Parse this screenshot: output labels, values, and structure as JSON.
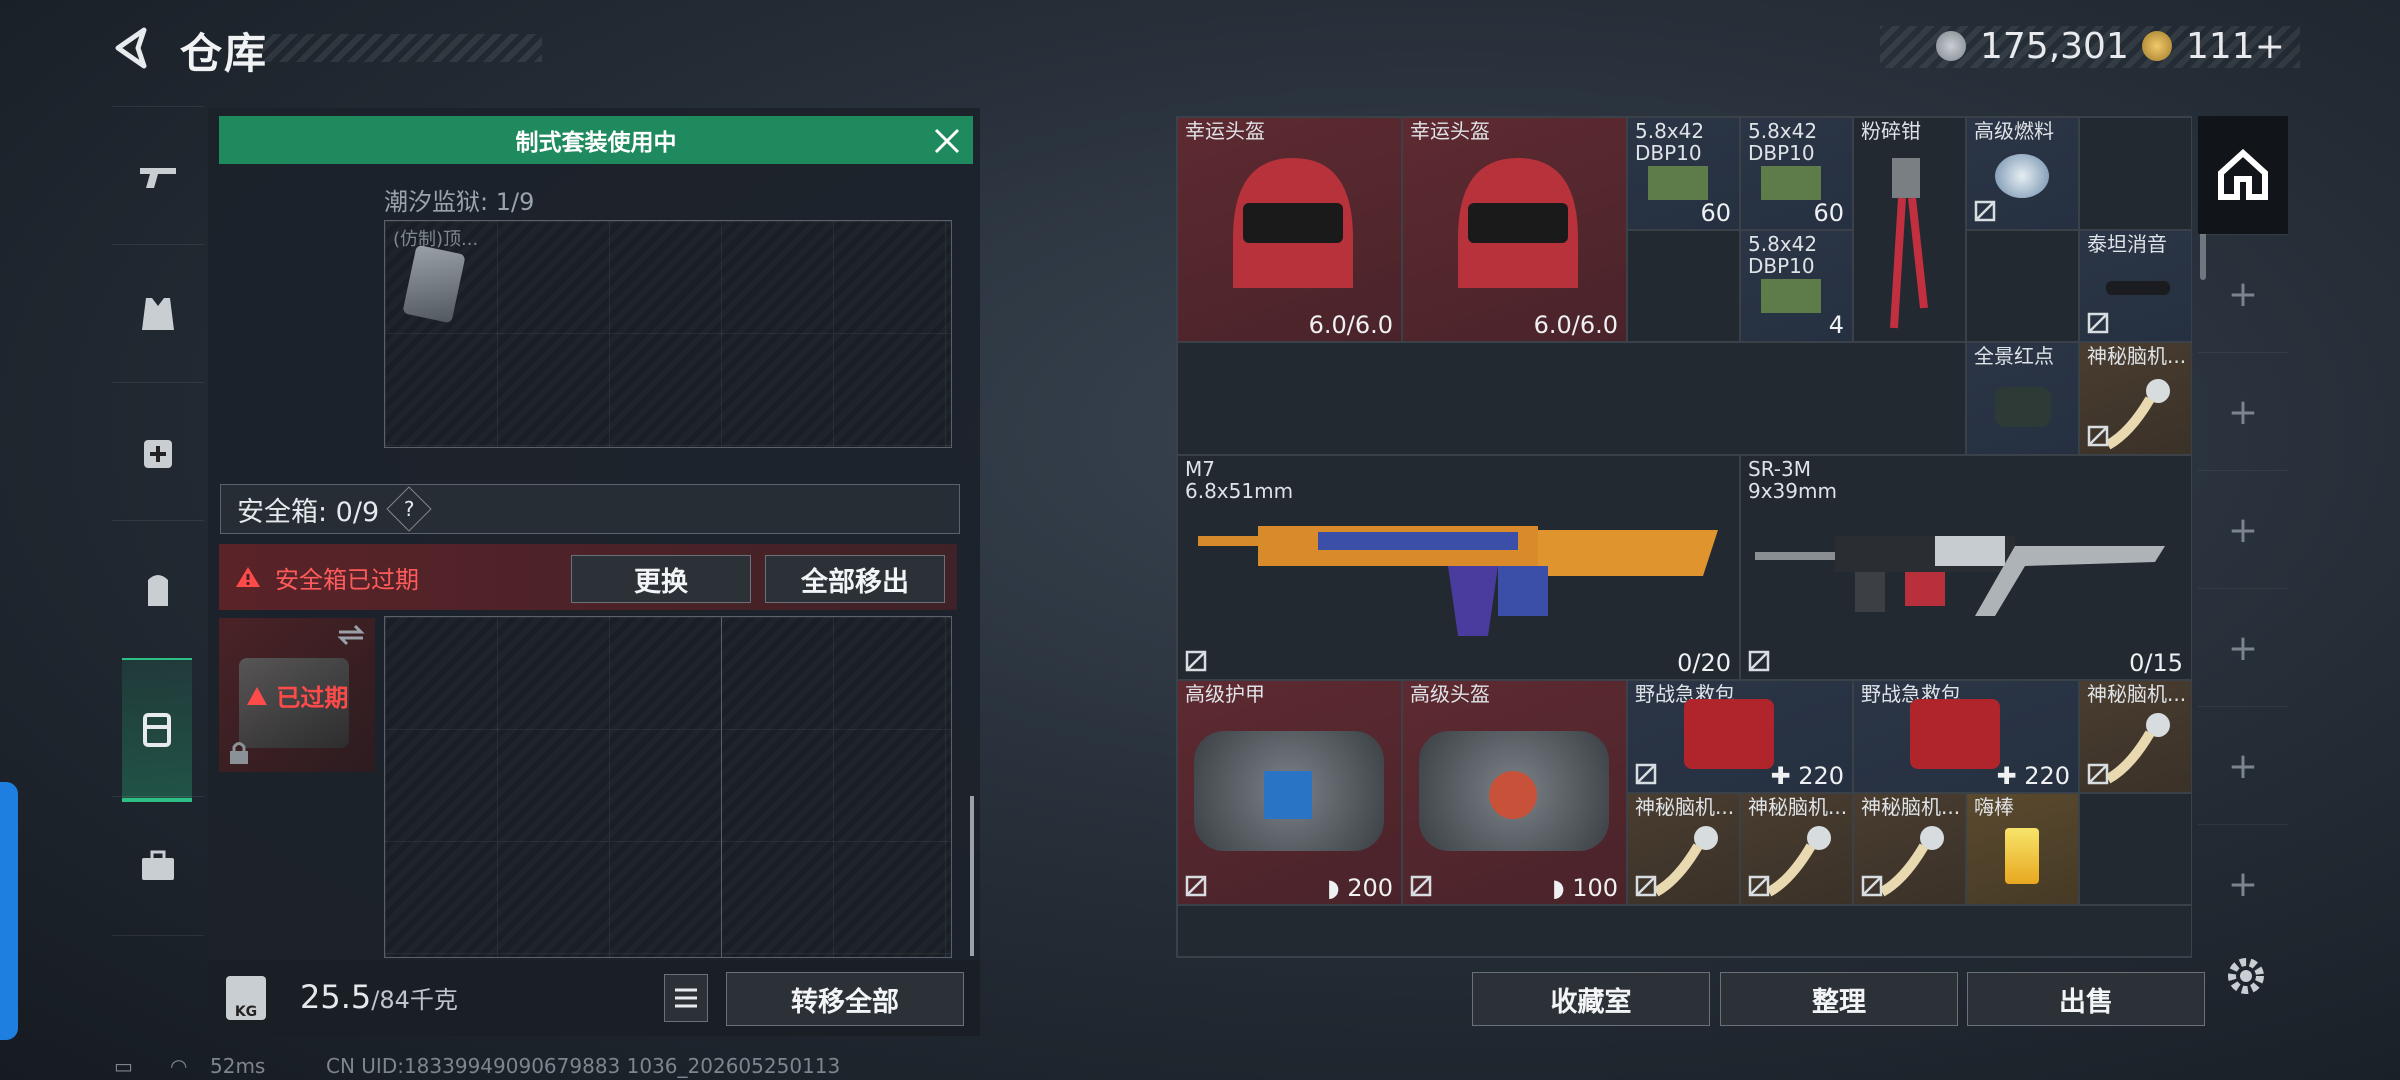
{
  "header": {
    "title": "仓库"
  },
  "currency": {
    "coins": "175,301",
    "tokens": "111+"
  },
  "kit_banner": "制式套装使用中",
  "tide_label": "潮汐监狱: 1/9",
  "tide_item": "(仿制)顶...",
  "safe_box": {
    "label": "安全箱: 0/9",
    "help": "?"
  },
  "warning": {
    "text": "安全箱已过期",
    "replace_btn": "更换",
    "move_all_btn": "全部移出"
  },
  "expired_label": "已过期",
  "weight": {
    "current": "25.5",
    "max": "/84千克",
    "kg_icon": "KG"
  },
  "transfer_all_btn": "转移全部",
  "inventory": {
    "helmet1": {
      "name": "幸运头盔",
      "value": "6.0/6.0"
    },
    "helmet2": {
      "name": "幸运头盔",
      "value": "6.0/6.0"
    },
    "ammo1": {
      "name": "5.8x42 DBP10",
      "value": "60"
    },
    "ammo2": {
      "name": "5.8x42 DBP10",
      "value": "60"
    },
    "ammo3": {
      "name": "5.8x42 DBP10",
      "value": "4"
    },
    "pliers": {
      "name": "粉碎钳"
    },
    "fuel": {
      "name": "高级燃料"
    },
    "silencer": {
      "name": "泰坦消音"
    },
    "reddot": {
      "name": "全景红点"
    },
    "brain1": {
      "name": "神秘脑机..."
    },
    "m7": {
      "name": "M7",
      "caliber": "6.8x51mm",
      "value": "0/20"
    },
    "sr3m": {
      "name": "SR-3M",
      "caliber": "9x39mm",
      "value": "0/15"
    },
    "armor": {
      "name": "高级护甲",
      "value": "200"
    },
    "helmet3": {
      "name": "高级头盔",
      "value": "100"
    },
    "medkit1": {
      "name": "野战急救包",
      "value": "220"
    },
    "medkit2": {
      "name": "野战急救包",
      "value": "220"
    },
    "brain2": {
      "name": "神秘脑机..."
    },
    "brain3": {
      "name": "神秘脑机..."
    },
    "brain4": {
      "name": "神秘脑机..."
    },
    "brain5": {
      "name": "神秘脑机..."
    },
    "glowstick": {
      "name": "嗨棒"
    }
  },
  "bottom_buttons": {
    "collection": "收藏室",
    "sort": "整理",
    "sell": "出售"
  },
  "status": {
    "ping": "52ms",
    "uid": "CN UID:18339949090679883 1036_202605250113"
  },
  "colors": {
    "accent_green": "#1f8a5e",
    "warning_red": "#ff5b5b"
  }
}
